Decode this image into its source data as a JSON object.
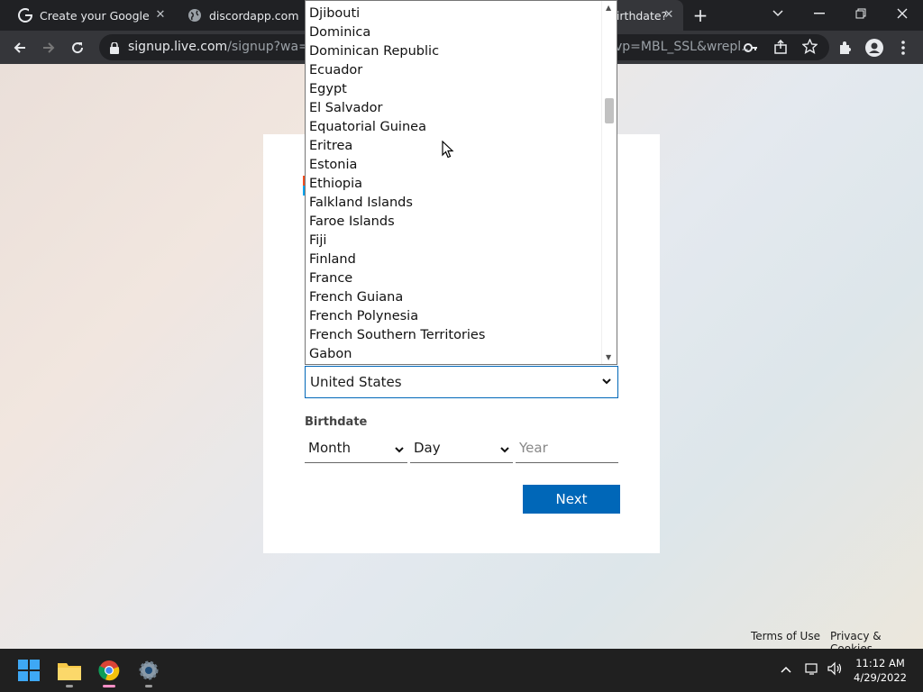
{
  "browser": {
    "tabs": [
      {
        "title": "Create your Google Ac",
        "favicon": "google-icon"
      },
      {
        "title": "discordapp.com",
        "favicon": "globe-icon"
      },
      {
        "title": "birthdate?",
        "favicon": "microsoft-icon",
        "active": true
      }
    ],
    "new_tab_label": "+",
    "url_host": "signup.live.com",
    "url_path": "/signup?wa=wsi",
    "url_tail": "vp=MBL_SSL&wrepl..."
  },
  "dropdown": {
    "options": [
      "Djibouti",
      "Dominica",
      "Dominican Republic",
      "Ecuador",
      "Egypt",
      "El Salvador",
      "Equatorial Guinea",
      "Eritrea",
      "Estonia",
      "Ethiopia",
      "Falkland Islands",
      "Faroe Islands",
      "Fiji",
      "Finland",
      "France",
      "French Guiana",
      "French Polynesia",
      "French Southern Territories",
      "Gabon"
    ]
  },
  "form": {
    "country_value": "United States",
    "birthdate_label": "Birthdate",
    "month_value": "Month",
    "day_value": "Day",
    "year_placeholder": "Year",
    "next_label": "Next"
  },
  "footer": {
    "terms": "Terms of Use",
    "privacy": "Privacy & Cookies"
  },
  "taskbar": {
    "time": "11:12 AM",
    "date": "4/29/2022"
  },
  "colors": {
    "accent": "#0067b8",
    "chrome_dark": "#202124"
  }
}
